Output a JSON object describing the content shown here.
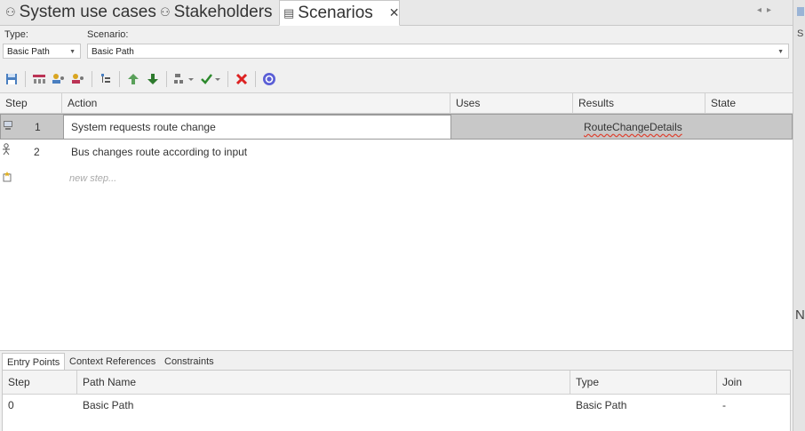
{
  "tabs": [
    {
      "label": "System use cases",
      "icon": "actor-pair-icon"
    },
    {
      "label": "Stakeholders",
      "icon": "actor-pair-icon"
    },
    {
      "label": "Scenarios",
      "icon": "document-icon",
      "close": "✕"
    }
  ],
  "type_field": {
    "label": "Type:",
    "value": "Basic Path"
  },
  "scenario_field": {
    "label": "Scenario:",
    "value": "Basic Path"
  },
  "toolbar": {
    "icons": [
      "save-icon",
      "structure-icon",
      "add-actor-icon",
      "add-system-icon",
      "hierarchy-icon",
      "move-up-icon",
      "move-down-icon",
      "generate-icon",
      "validate-icon",
      "delete-icon",
      "help-icon"
    ]
  },
  "grid": {
    "columns": [
      "Step",
      "Action",
      "Uses",
      "Results",
      "State"
    ],
    "rows": [
      {
        "icon": "system-icon",
        "step": "1",
        "action": "System requests route change",
        "uses": "",
        "results": "RouteChangeDetails",
        "state": ""
      },
      {
        "icon": "actor-icon",
        "step": "2",
        "action": "Bus changes route according to input",
        "uses": "",
        "results": "",
        "state": ""
      }
    ],
    "new_step": "new step..."
  },
  "bottom_tabs": [
    "Entry Points",
    "Context References",
    "Constraints"
  ],
  "entry_points": {
    "columns": [
      "Step",
      "Path Name",
      "Type",
      "Join"
    ],
    "rows": [
      {
        "step": "0",
        "path_name": "Basic Path",
        "type": "Basic Path",
        "join": "-"
      }
    ]
  },
  "right_panel": {
    "label_top": "S",
    "label_mid": "N"
  }
}
